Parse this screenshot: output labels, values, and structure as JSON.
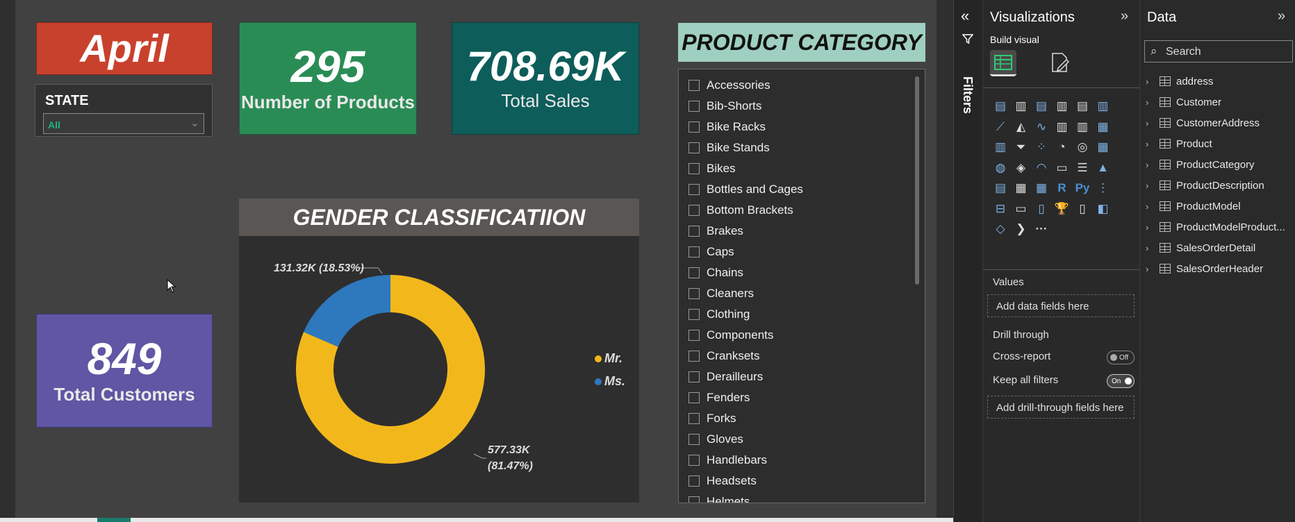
{
  "cards": {
    "month": "April",
    "products": {
      "value": "295",
      "label": "Number of Products"
    },
    "sales": {
      "value": "708.69K",
      "label": "Total Sales"
    },
    "customers": {
      "value": "849",
      "label": "Total Customers"
    }
  },
  "state_slicer": {
    "label": "STATE",
    "value": "All"
  },
  "gender_chart": {
    "title": "GENDER CLASSIFICATIION",
    "label_ms": "131.32K (18.53%)",
    "label_mr_line1": "577.33K",
    "label_mr_line2": "(81.47%)",
    "legend": [
      "Mr.",
      "Ms."
    ]
  },
  "chart_data": {
    "type": "pie",
    "title": "GENDER CLASSIFICATIION",
    "categories": [
      "Mr.",
      "Ms."
    ],
    "values": [
      577.33,
      131.32
    ],
    "percentages": [
      81.47,
      18.53
    ],
    "colors": [
      "#f2b81b",
      "#2e78bd"
    ],
    "donut": true,
    "legend_position": "right"
  },
  "product_category": {
    "title": "PRODUCT CATEGORY",
    "items": [
      "Accessories",
      "Bib-Shorts",
      "Bike Racks",
      "Bike Stands",
      "Bikes",
      "Bottles and Cages",
      "Bottom Brackets",
      "Brakes",
      "Caps",
      "Chains",
      "Cleaners",
      "Clothing",
      "Components",
      "Cranksets",
      "Derailleurs",
      "Fenders",
      "Forks",
      "Gloves",
      "Handlebars",
      "Headsets",
      "Helmets"
    ]
  },
  "filters_strip": {
    "label": "Filters"
  },
  "visualizations": {
    "title": "Visualizations",
    "build_visual": "Build visual",
    "values_label": "Values",
    "values_well": "Add data fields here",
    "drill_through": "Drill through",
    "cross_report": "Cross-report",
    "cross_report_state": "Off",
    "keep_filters": "Keep all filters",
    "keep_filters_state": "On",
    "drill_well": "Add drill-through fields here",
    "r_icon": "R",
    "py_icon": "Py",
    "more": "···"
  },
  "data_pane": {
    "title": "Data",
    "search_placeholder": "Search",
    "tables": [
      "address",
      "Customer",
      "CustomerAddress",
      "Product",
      "ProductCategory",
      "ProductDescription",
      "ProductModel",
      "ProductModelProduct...",
      "SalesOrderDetail",
      "SalesOrderHeader"
    ]
  },
  "colors": {
    "april": "#c8412d",
    "products": "#2a8c55",
    "sales": "#0d5d5a",
    "customers": "#5f56a4",
    "mr": "#f2b81b",
    "ms": "#2e78bd"
  }
}
